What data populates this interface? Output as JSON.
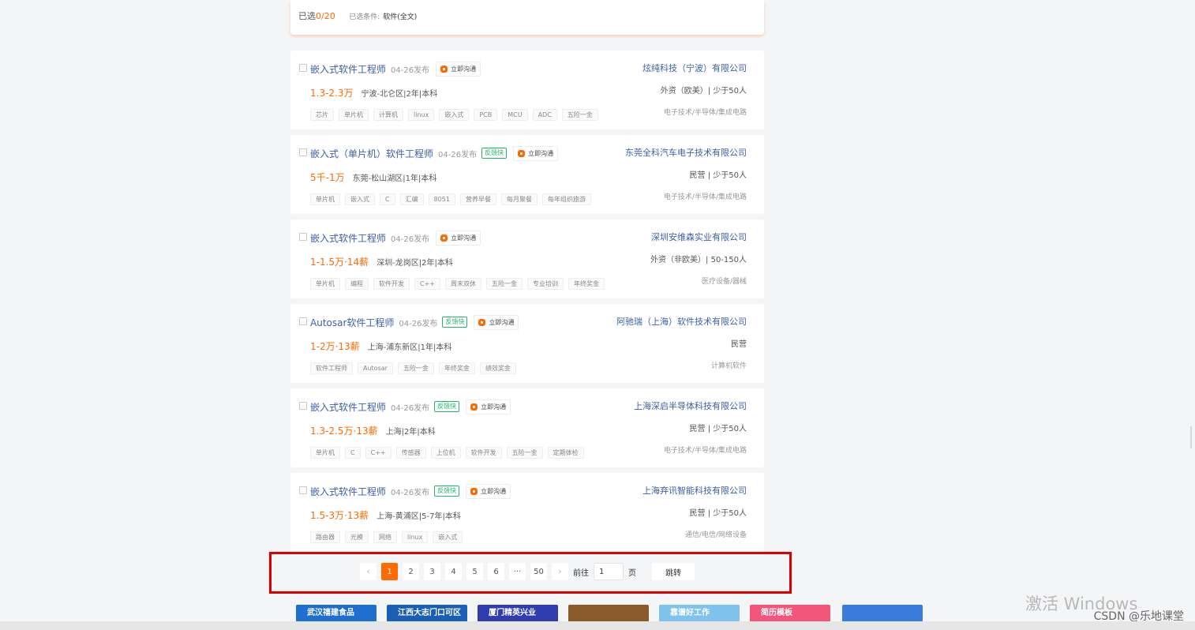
{
  "summary": {
    "selected_label": "已选",
    "selected_count": "0/20",
    "condition_label": "已选条件:",
    "condition_value": "软件(全文)"
  },
  "jobs": [
    {
      "title": "嵌入式软件工程师",
      "date": "04-26发布",
      "fast": "",
      "chat": "立即沟通",
      "salary": "1.3-2.3万",
      "area": "宁波-北仑区|2年|本科",
      "tags": [
        "芯片",
        "单片机",
        "计算机",
        "linux",
        "嵌入式",
        "PCB",
        "MCU",
        "ADC",
        "五险一金"
      ],
      "company": "炫纯科技（宁波）有限公司",
      "company_type": "外资（欧美）| 少于50人",
      "industry": "电子技术/半导体/集成电路"
    },
    {
      "title": "嵌入式（单片机）软件工程师",
      "date": "04-26发布",
      "fast": "反馈快",
      "chat": "立即沟通",
      "salary": "5千-1万",
      "area": "东莞-松山湖区|1年|本科",
      "tags": [
        "单片机",
        "嵌入式",
        "C",
        "汇编",
        "8051",
        "营养早餐",
        "每月聚餐",
        "每年组织旅游"
      ],
      "company": "东莞全科汽车电子技术有限公司",
      "company_type": "民营 | 少于50人",
      "industry": "电子技术/半导体/集成电路"
    },
    {
      "title": "嵌入式软件工程师",
      "date": "04-26发布",
      "fast": "",
      "chat": "立即沟通",
      "salary": "1-1.5万·14薪",
      "area": "深圳-龙岗区|2年|本科",
      "tags": [
        "单片机",
        "编程",
        "软件开发",
        "C++",
        "周末双休",
        "五险一金",
        "专业培训",
        "年终奖金"
      ],
      "company": "深圳安维森实业有限公司",
      "company_type": "外资（非欧美）| 50-150人",
      "industry": "医疗设备/器械"
    },
    {
      "title": "Autosar软件工程师",
      "date": "04-26发布",
      "fast": "反馈快",
      "chat": "立即沟通",
      "salary": "1-2万·13薪",
      "area": "上海-浦东新区|1年|本科",
      "tags": [
        "软件工程师",
        "Autosar",
        "五险一金",
        "年终奖金",
        "绩效奖金"
      ],
      "company": "阿驰瑞（上海）软件技术有限公司",
      "company_type": "民营",
      "industry": "计算机软件"
    },
    {
      "title": "嵌入式软件工程师",
      "date": "04-26发布",
      "fast": "反馈快",
      "chat": "立即沟通",
      "salary": "1.3-2.5万·13薪",
      "area": "上海|2年|本科",
      "tags": [
        "单片机",
        "C",
        "C++",
        "传感器",
        "上位机",
        "软件开发",
        "五险一金",
        "定期体检"
      ],
      "company": "上海深启半导体科技有限公司",
      "company_type": "民营 | 少于50人",
      "industry": "电子技术/半导体/集成电路"
    },
    {
      "title": "嵌入式软件工程师",
      "date": "04-26发布",
      "fast": "反馈快",
      "chat": "立即沟通",
      "salary": "1.5-3万·13薪",
      "area": "上海-黄浦区|5-7年|本科",
      "tags": [
        "路由器",
        "光模",
        "网络",
        "linux",
        "嵌入式"
      ],
      "company": "上海弃讯智能科技有限公司",
      "company_type": "民营 | 少于50人",
      "industry": "通信/电信/网络设备"
    }
  ],
  "pagination": {
    "prev": "‹",
    "pages": [
      "1",
      "2",
      "3",
      "4",
      "5",
      "6",
      "···",
      "50"
    ],
    "next": "›",
    "goto_label": "前往",
    "goto_value": "1",
    "page_unit": "页",
    "jump_label": "跳转"
  },
  "banners": [
    {
      "text": "武汉禧建食品",
      "color": "#1f6fd1"
    },
    {
      "text": "江西大志门口可区",
      "color": "#1a5fb4"
    },
    {
      "text": "厦门精英兴业",
      "color": "#2f3db0"
    },
    {
      "text": "",
      "color": "#8a5a2b"
    },
    {
      "text": "靠谱好工作",
      "color": "#7fc2ec"
    },
    {
      "text": "简历模板",
      "color": "#f2567a"
    },
    {
      "text": "",
      "color": "#3b7bdb"
    }
  ],
  "watermark": {
    "windows": "激活 Windows",
    "csdn": "CSDN @乐地课堂"
  }
}
